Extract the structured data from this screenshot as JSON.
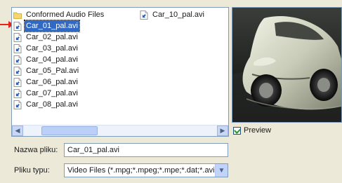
{
  "file_list": {
    "column_1": [
      {
        "label": "Conformed Audio Files",
        "type": "folder",
        "icon": "folder-icon"
      },
      {
        "label": "Car_01_pal.avi",
        "type": "file",
        "icon": "video-file-icon",
        "selected": true
      },
      {
        "label": "Car_02_pal.avi",
        "type": "file",
        "icon": "video-file-icon"
      },
      {
        "label": "Car_03_pal.avi",
        "type": "file",
        "icon": "video-file-icon"
      },
      {
        "label": "Car_04_pal.avi",
        "type": "file",
        "icon": "video-file-icon"
      },
      {
        "label": "Car_05_Pal.avi",
        "type": "file",
        "icon": "video-file-icon"
      },
      {
        "label": "Car_06_pal.avi",
        "type": "file",
        "icon": "video-file-icon"
      },
      {
        "label": "Car_07_pal.avi",
        "type": "file",
        "icon": "video-file-icon"
      },
      {
        "label": "Car_08_pal.avi",
        "type": "file",
        "icon": "video-file-icon"
      }
    ],
    "column_2": [
      {
        "label": "Car_10_pal.avi",
        "type": "file",
        "icon": "video-file-icon"
      }
    ]
  },
  "preview": {
    "checkbox_label": "Preview",
    "checked": true
  },
  "form": {
    "name_label": "Nazwa pliku:",
    "name_value": "Car_01_pal.avi",
    "type_label": "Pliku typu:",
    "type_value": "Video Files (*.mpg;*.mpeg;*.mpe;*.dat;*.avi;)"
  },
  "colors": {
    "selection": "#316ac5",
    "pointer_arrow": "#e8231c",
    "dialog_bg": "#ece9d8"
  }
}
